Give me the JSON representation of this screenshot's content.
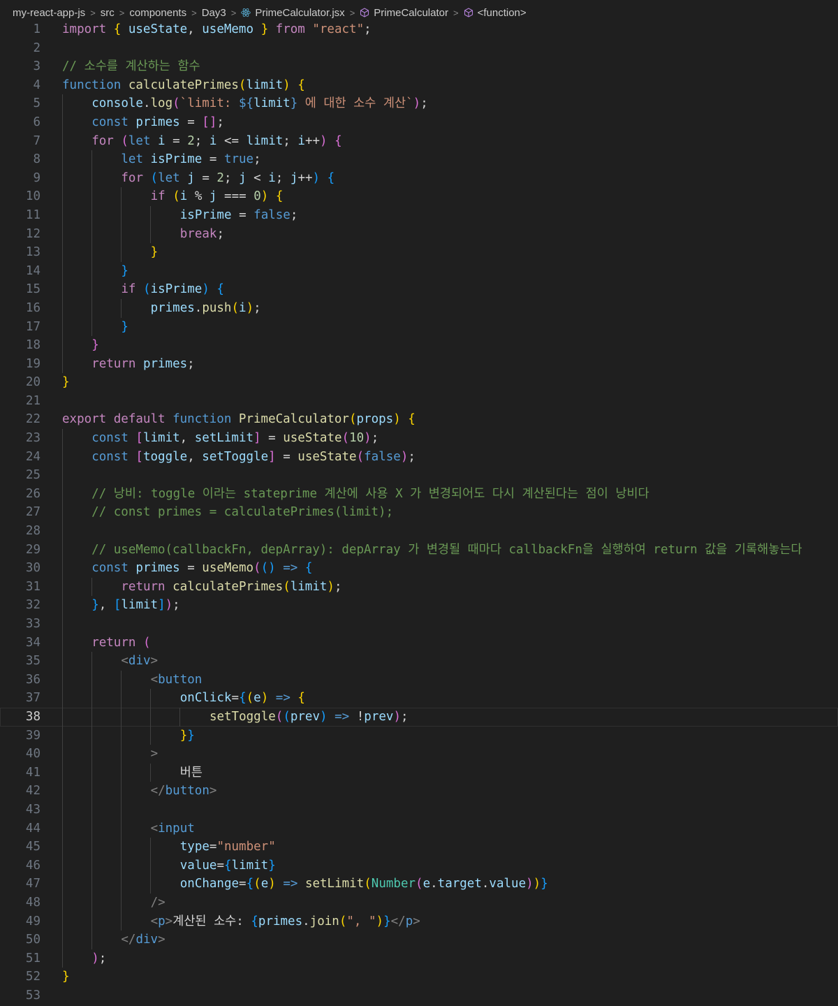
{
  "breadcrumb": {
    "items": [
      "my-react-app-js",
      "src",
      "components",
      "Day3",
      "PrimeCalculator.jsx",
      "PrimeCalculator",
      "<function>"
    ]
  },
  "editor": {
    "current_line": 38,
    "lines": [
      "import { useState, useMemo } from \"react\";",
      "",
      "// 소수를 계산하는 함수",
      "function calculatePrimes(limit) {",
      "    console.log(`limit: ${limit} 에 대한 소수 계산`);",
      "    const primes = [];",
      "    for (let i = 2; i <= limit; i++) {",
      "        let isPrime = true;",
      "        for (let j = 2; j < i; j++) {",
      "            if (i % j === 0) {",
      "                isPrime = false;",
      "                break;",
      "            }",
      "        }",
      "        if (isPrime) {",
      "            primes.push(i);",
      "        }",
      "    }",
      "    return primes;",
      "}",
      "",
      "export default function PrimeCalculator(props) {",
      "    const [limit, setLimit] = useState(10);",
      "    const [toggle, setToggle] = useState(false);",
      "",
      "    // 낭비: toggle 이라는 stateprime 계산에 사용 X 가 변경되어도 다시 계산된다는 점이 낭비다",
      "    // const primes = calculatePrimes(limit);",
      "",
      "    // useMemo(callbackFn, depArray): depArray 가 변경될 때마다 callbackFn을 실행하여 return 값을 기록해놓는다",
      "    const primes = useMemo(() => {",
      "        return calculatePrimes(limit);",
      "    }, [limit]);",
      "",
      "    return (",
      "        <div>",
      "            <button",
      "                onClick={(e) => {",
      "                    setToggle((prev) => !prev);",
      "                }}",
      "            >",
      "                버튼",
      "            </button>",
      "",
      "            <input",
      "                type=\"number\"",
      "                value={limit}",
      "                onChange={(e) => setLimit(Number(e.target.value))}",
      "            />",
      "            <p>계산된 소수: {primes.join(\", \")}</p>",
      "        </div>",
      "    );",
      "}",
      ""
    ]
  },
  "colors": {
    "background": "#1f1f1f",
    "keyword_control": "#c586c0",
    "keyword_storage": "#569cd6",
    "function": "#dcdcaa",
    "variable": "#9cdcfe",
    "string": "#ce9178",
    "number": "#b5cea8",
    "comment": "#6a9955",
    "bracket_1": "#ffd700",
    "bracket_2": "#da70d6",
    "bracket_3": "#179fff",
    "line_number": "#6e7681"
  },
  "icons": {
    "jsx_file": "react-icon",
    "component": "cube-icon",
    "function": "cube-icon"
  }
}
